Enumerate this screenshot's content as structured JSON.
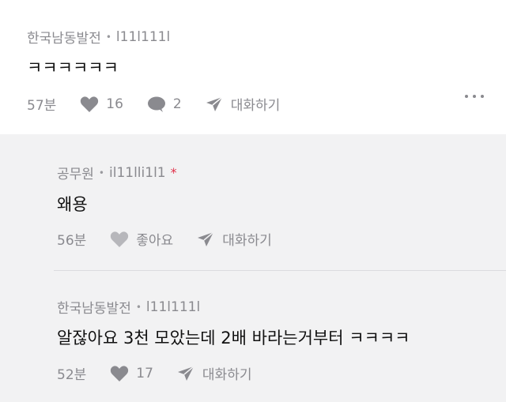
{
  "post": {
    "author": "한국남동발전",
    "username": "l11l111l",
    "content": "ㅋㅋㅋㅋㅋㅋ",
    "time": "57분",
    "likes": "16",
    "comments": "2",
    "chat_label": "대화하기",
    "more_icon": "more-dots-icon"
  },
  "replies": [
    {
      "author": "공무원",
      "username": "il11lli1l1",
      "star": "*",
      "content": "왜용",
      "time": "56분",
      "like_label": "좋아요",
      "chat_label": "대화하기"
    },
    {
      "author": "한국남동발전",
      "username": "l11l111l",
      "content": "알잖아요 3천 모았는데 2배 바라는거부터 ㅋㅋㅋㅋ",
      "time": "52분",
      "likes": "17",
      "chat_label": "대화하기"
    }
  ],
  "colors": {
    "reply_background": "#f2f2f3",
    "muted_text": "#8a8a8f",
    "star": "#e0314a"
  }
}
